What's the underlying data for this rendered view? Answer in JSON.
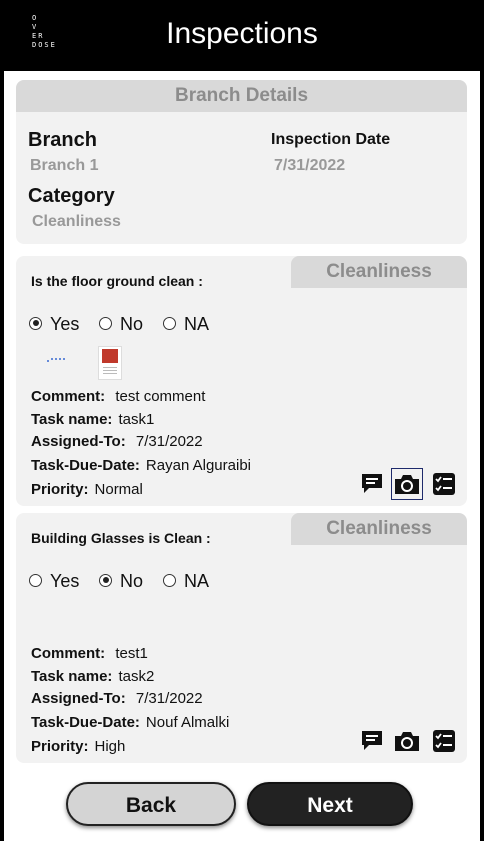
{
  "header": {
    "logo_lines": [
      "O",
      "V",
      "ER",
      "DOSE"
    ],
    "title": "Inspections"
  },
  "branch_details": {
    "section_title": "Branch Details",
    "branch_label": "Branch",
    "branch_value": "Branch 1",
    "date_label": "Inspection Date",
    "date_value": "7/31/2022",
    "category_label": "Category",
    "category_value": "Cleanliness"
  },
  "questions": [
    {
      "category": "Cleanliness",
      "text": "Is the floor ground clean :",
      "options": [
        "Yes",
        "No",
        "NA"
      ],
      "selected": "Yes",
      "has_attachments": true,
      "comment_label": "Comment:",
      "comment": "test comment",
      "task_name_label": "Task name:",
      "task_name": "task1",
      "assigned_label": "Assigned-To:",
      "assigned": "7/31/2022",
      "due_label": "Task-Due-Date:",
      "due": "Rayan Alguraibi",
      "priority_label": "Priority:",
      "priority": "Normal",
      "camera_selected": true
    },
    {
      "category": "Cleanliness",
      "text": "Building Glasses is Clean :",
      "options": [
        "Yes",
        "No",
        "NA"
      ],
      "selected": "No",
      "has_attachments": false,
      "comment_label": "Comment:",
      "comment": "test1",
      "task_name_label": "Task name:",
      "task_name": "task2",
      "assigned_label": "Assigned-To:",
      "assigned": "7/31/2022",
      "due_label": "Task-Due-Date:",
      "due": "Nouf Almalki",
      "priority_label": "Priority:",
      "priority": "High",
      "camera_selected": false
    }
  ],
  "actions": {
    "icons": [
      "comment-icon",
      "camera-icon",
      "checklist-icon"
    ]
  },
  "footer": {
    "back_label": "Back",
    "next_label": "Next"
  }
}
